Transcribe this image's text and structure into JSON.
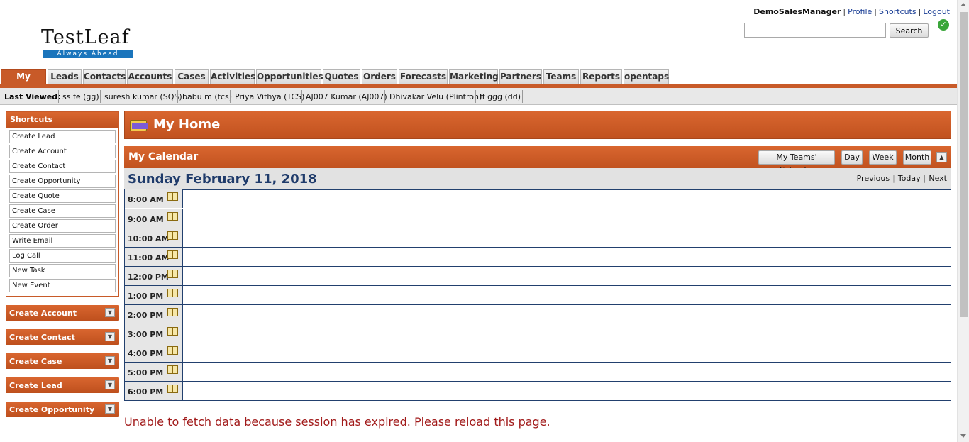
{
  "brand": {
    "logo_main": "TestLeaf",
    "logo_tagline": "Always Ahead"
  },
  "user": {
    "name": "DemoSalesManager",
    "links": [
      "Profile",
      "Shortcuts",
      "Logout"
    ]
  },
  "search": {
    "value": "",
    "button_label": "Search"
  },
  "tabs": [
    "My Home",
    "Leads",
    "Contacts",
    "Accounts",
    "Cases",
    "Activities",
    "Opportunities",
    "Quotes",
    "Orders",
    "Forecasts",
    "Marketing",
    "Partners",
    "Teams",
    "Reports",
    "opentaps"
  ],
  "active_tab": "My Home",
  "last_viewed": {
    "label": "Last Viewed:",
    "items": [
      "ss fe (gg)",
      "suresh kumar (SQS)",
      "babu m (tcs)",
      "Priya Vithya (TCS)",
      "AJ007 Kumar (AJ007)",
      "Dhivakar Velu (Plintron)",
      "ff ggg (dd)"
    ]
  },
  "shortcuts": {
    "title": "Shortcuts",
    "items": [
      "Create Lead",
      "Create Account",
      "Create Contact",
      "Create Opportunity",
      "Create Quote",
      "Create Case",
      "Create Order",
      "Write Email",
      "Log Call",
      "New Task",
      "New Event"
    ]
  },
  "side_boxes": [
    "Create Account",
    "Create Contact",
    "Create Case",
    "Create Lead",
    "Create Opportunity"
  ],
  "page_title": "My Home",
  "calendar": {
    "title": "My Calendar",
    "buttons": [
      "My Teams' Calendar",
      "Day",
      "Week",
      "Month"
    ],
    "date": "Sunday February 11, 2018",
    "nav": [
      "Previous",
      "Today",
      "Next"
    ],
    "hours": [
      "8:00 AM",
      "9:00 AM",
      "10:00 AM",
      "11:00 AM",
      "12:00 PM",
      "1:00 PM",
      "2:00 PM",
      "3:00 PM",
      "4:00 PM",
      "5:00 PM",
      "6:00 PM"
    ]
  },
  "error_message": "Unable to fetch data because session has expired. Please reload this page.",
  "colors": {
    "accent": "#c85a28",
    "link": "#1a3e95",
    "date_title": "#1f3b6b",
    "error": "#a11a1a"
  }
}
